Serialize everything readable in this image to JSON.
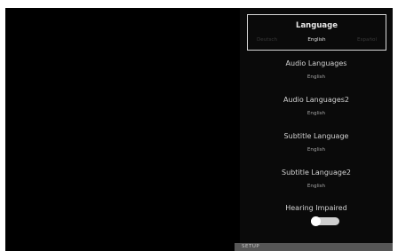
{
  "language": {
    "title": "Language",
    "options": [
      "Deutsch",
      "English",
      "Español"
    ],
    "selected": "English"
  },
  "items": [
    {
      "title": "Audio Languages",
      "value": "English"
    },
    {
      "title": "Audio Languages2",
      "value": "English"
    },
    {
      "title": "Subtitle Language",
      "value": "English"
    },
    {
      "title": "Subtitle Language2",
      "value": "English"
    }
  ],
  "hearing_impaired": {
    "title": "Hearing Impaired",
    "enabled": false
  },
  "footer": {
    "label": "SETUP"
  },
  "colors": {
    "background": "#000000",
    "panel": "#0a0a0a",
    "setup_bar": "#565656"
  }
}
